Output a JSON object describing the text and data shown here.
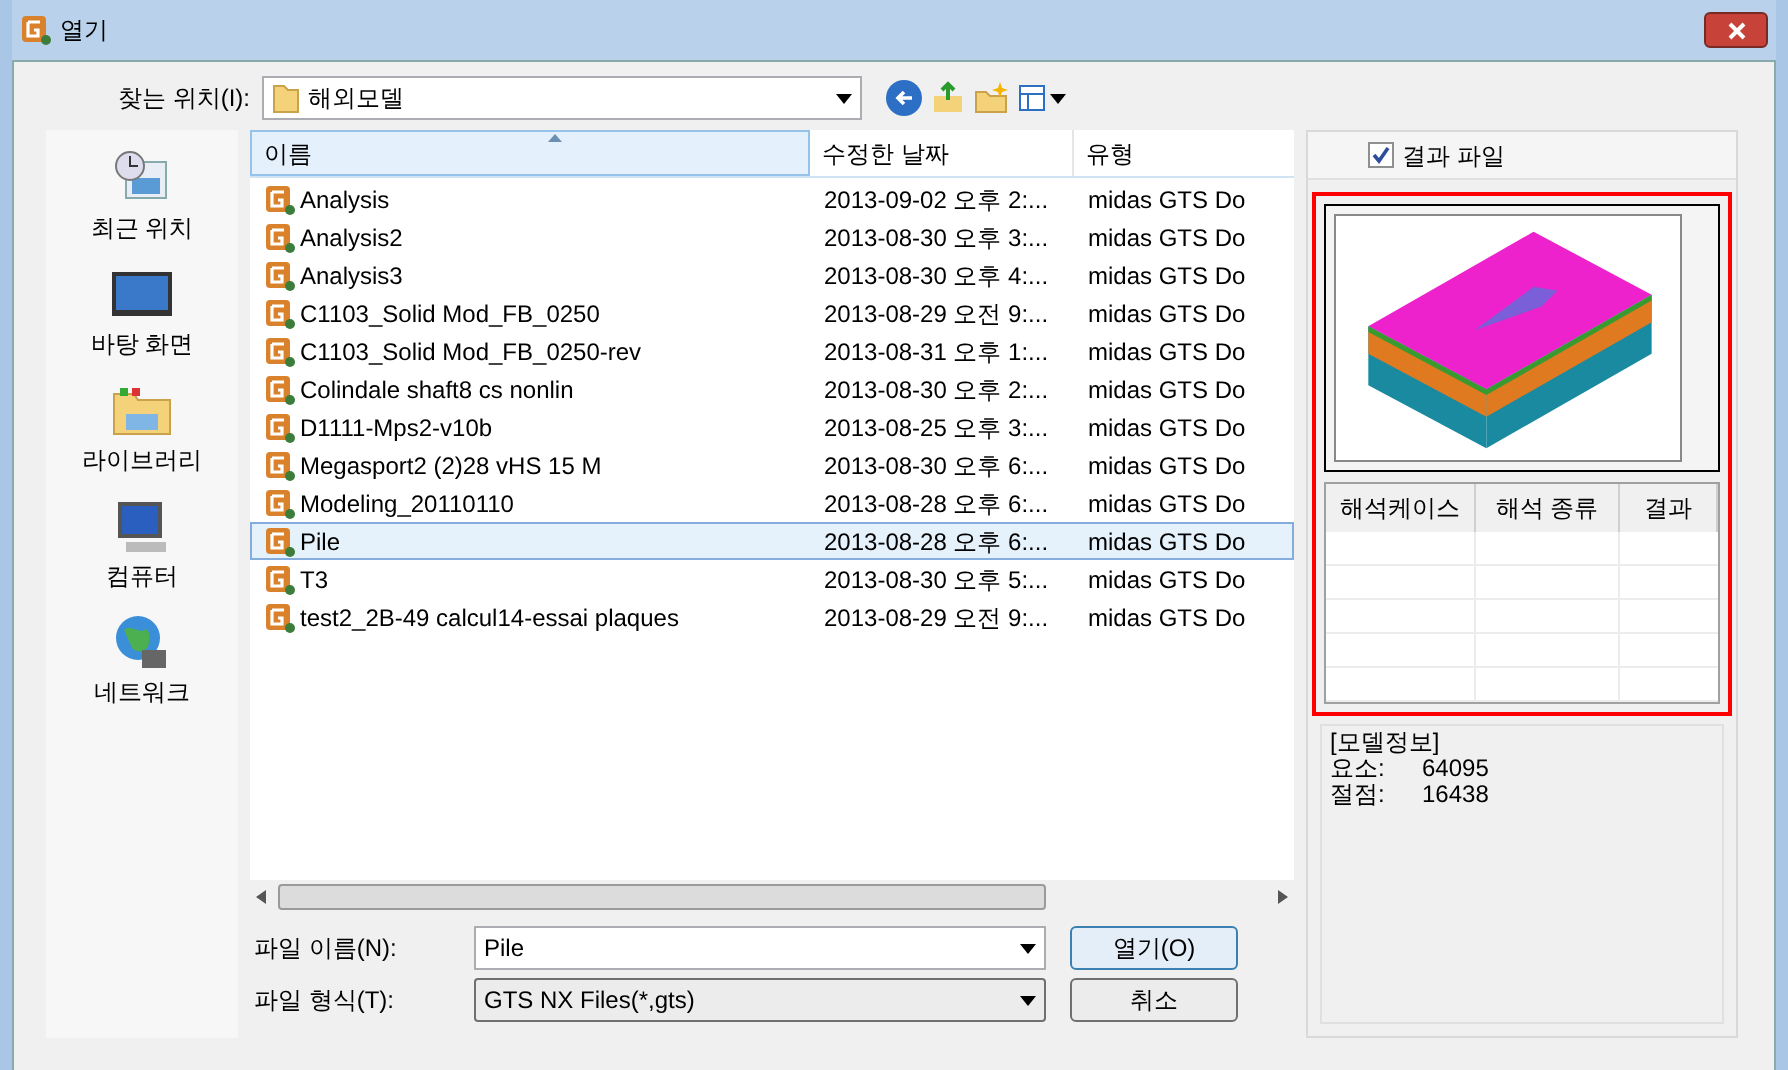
{
  "window": {
    "title": "열기"
  },
  "location": {
    "label": "찾는 위치(I):",
    "value": "해외모델"
  },
  "places": [
    {
      "label": "최근 위치",
      "kind": "recent"
    },
    {
      "label": "바탕 화면",
      "kind": "desktop"
    },
    {
      "label": "라이브러리",
      "kind": "library"
    },
    {
      "label": "컴퓨터",
      "kind": "computer"
    },
    {
      "label": "네트워크",
      "kind": "network"
    }
  ],
  "file_list": {
    "columns": [
      "이름",
      "수정한 날짜",
      "유형"
    ],
    "rows": [
      {
        "name": "Analysis",
        "date": "2013-09-02 오후 2:...",
        "type": "midas GTS Do",
        "selected": false
      },
      {
        "name": "Analysis2",
        "date": "2013-08-30 오후 3:...",
        "type": "midas GTS Do",
        "selected": false
      },
      {
        "name": "Analysis3",
        "date": "2013-08-30 오후 4:...",
        "type": "midas GTS Do",
        "selected": false
      },
      {
        "name": "C1103_Solid Mod_FB_0250",
        "date": "2013-08-29 오전 9:...",
        "type": "midas GTS Do",
        "selected": false
      },
      {
        "name": "C1103_Solid Mod_FB_0250-rev",
        "date": "2013-08-31 오후 1:...",
        "type": "midas GTS Do",
        "selected": false
      },
      {
        "name": "Colindale shaft8 cs nonlin",
        "date": "2013-08-30 오후 2:...",
        "type": "midas GTS Do",
        "selected": false
      },
      {
        "name": "D1111-Mps2-v10b",
        "date": "2013-08-25 오후 3:...",
        "type": "midas GTS Do",
        "selected": false
      },
      {
        "name": "Megasport2 (2)28 vHS 15 M",
        "date": "2013-08-30 오후 6:...",
        "type": "midas GTS Do",
        "selected": false
      },
      {
        "name": "Modeling_20110110",
        "date": "2013-08-28 오후 6:...",
        "type": "midas GTS Do",
        "selected": false
      },
      {
        "name": "Pile",
        "date": "2013-08-28 오후 6:...",
        "type": "midas GTS Do",
        "selected": true
      },
      {
        "name": "T3",
        "date": "2013-08-30 오후 5:...",
        "type": "midas GTS Do",
        "selected": false
      },
      {
        "name": "test2_2B-49 calcul14-essai plaques",
        "date": "2013-08-29 오전 9:...",
        "type": "midas GTS Do",
        "selected": false
      }
    ]
  },
  "result_file": {
    "label": "결과 파일",
    "checked": true
  },
  "result_table": {
    "columns": [
      "해석케이스",
      "해석 종류",
      "결과"
    ]
  },
  "model_info": {
    "heading": "[모델정보]",
    "items": [
      {
        "label": "요소:",
        "value": "64095"
      },
      {
        "label": "절점:",
        "value": "16438"
      }
    ]
  },
  "file_name": {
    "label": "파일 이름(N):",
    "value": "Pile"
  },
  "file_type": {
    "label": "파일 형식(T):",
    "value": "GTS NX Files(*,gts)"
  },
  "buttons": [
    "열기(O)",
    "취소"
  ]
}
